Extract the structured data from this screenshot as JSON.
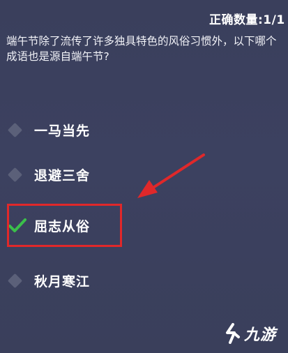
{
  "score": {
    "label": "正确数量:1/1"
  },
  "question": {
    "text": "端午节除了流传了许多独具特色的风俗习惯外，以下哪个成语也是源自端午节?"
  },
  "options": [
    {
      "label": "一马当先",
      "selected": false
    },
    {
      "label": "退避三舍",
      "selected": false
    },
    {
      "label": "屈志从俗",
      "selected": true
    },
    {
      "label": "秋月寒江",
      "selected": false
    }
  ],
  "watermark": {
    "logo_text": "九游"
  },
  "colors": {
    "annotation_red": "#e0282a",
    "check_green": "#3bbf4a",
    "background": "#3a3f5c"
  }
}
